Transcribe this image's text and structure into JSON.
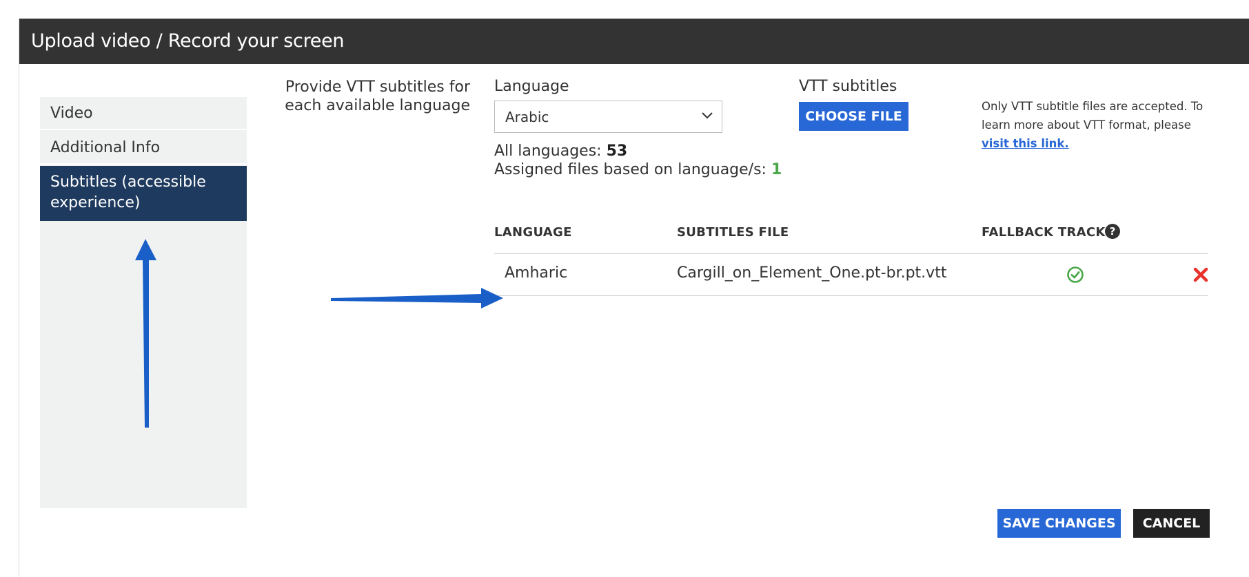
{
  "modal": {
    "title": "Upload video / Record your screen"
  },
  "sidebar": {
    "items": [
      {
        "label": "Video",
        "active": false
      },
      {
        "label": "Additional Info",
        "active": false
      },
      {
        "label": "Subtitles (accessible experience)",
        "active": true
      }
    ]
  },
  "subtitles": {
    "section_label": "Provide VTT subtitles for each available language",
    "language_label": "Language",
    "language_selected": "Arabic",
    "vtt_label": "VTT subtitles",
    "choose_file_label": "CHOOSE FILE",
    "note_text": "Only VTT subtitle files are accepted. To learn more about VTT format, please ",
    "note_link": "visit this link.",
    "stats": {
      "all_languages_label": "All languages: ",
      "all_languages_value": "53",
      "assigned_label": "Assigned files based on language/s: ",
      "assigned_value": "1"
    },
    "table": {
      "columns": [
        "LANGUAGE",
        "SUBTITLES FILE",
        "FALLBACK TRACK"
      ],
      "help_glyph": "?",
      "rows": [
        {
          "language": "Amharic",
          "file": "Cargill_on_Element_One.pt-br.pt.vtt",
          "fallback": true
        }
      ]
    }
  },
  "footer": {
    "save_label": "SAVE CHANGES",
    "cancel_label": "CANCEL"
  },
  "colors": {
    "header_bg": "#333333",
    "primary": "#2767d6",
    "active_nav": "#1f3a5f",
    "success": "#4aa84a",
    "danger": "#e8322b",
    "annotation_arrow": "#1a5fc8"
  }
}
